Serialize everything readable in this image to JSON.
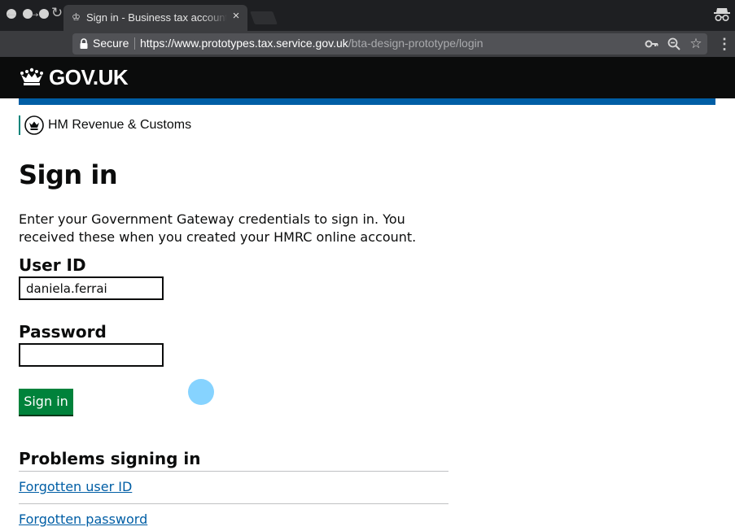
{
  "browser": {
    "tab_title": "Sign in - Business tax account",
    "tab_close": "×",
    "secure_label": "Secure",
    "url_host": "https://www.prototypes.tax.service.gov.uk",
    "url_path": "/bta-design-prototype/login"
  },
  "header": {
    "logo_text": "GOV.UK",
    "brand_color": "#005ea5"
  },
  "organisation": {
    "name": "HM Revenue & Customs"
  },
  "main": {
    "title": "Sign in",
    "lede": "Enter your Government Gateway credentials to sign in. You received these when you created your HMRC online account.",
    "user_id_label": "User ID",
    "user_id_value": "daniela.ferrai",
    "password_label": "Password",
    "password_value": "",
    "signin_button": "Sign in",
    "button_color": "#00823b"
  },
  "problems": {
    "heading": "Problems signing in",
    "links": [
      "Forgotten user ID",
      "Forgotten password"
    ],
    "link_color": "#005ea5"
  }
}
